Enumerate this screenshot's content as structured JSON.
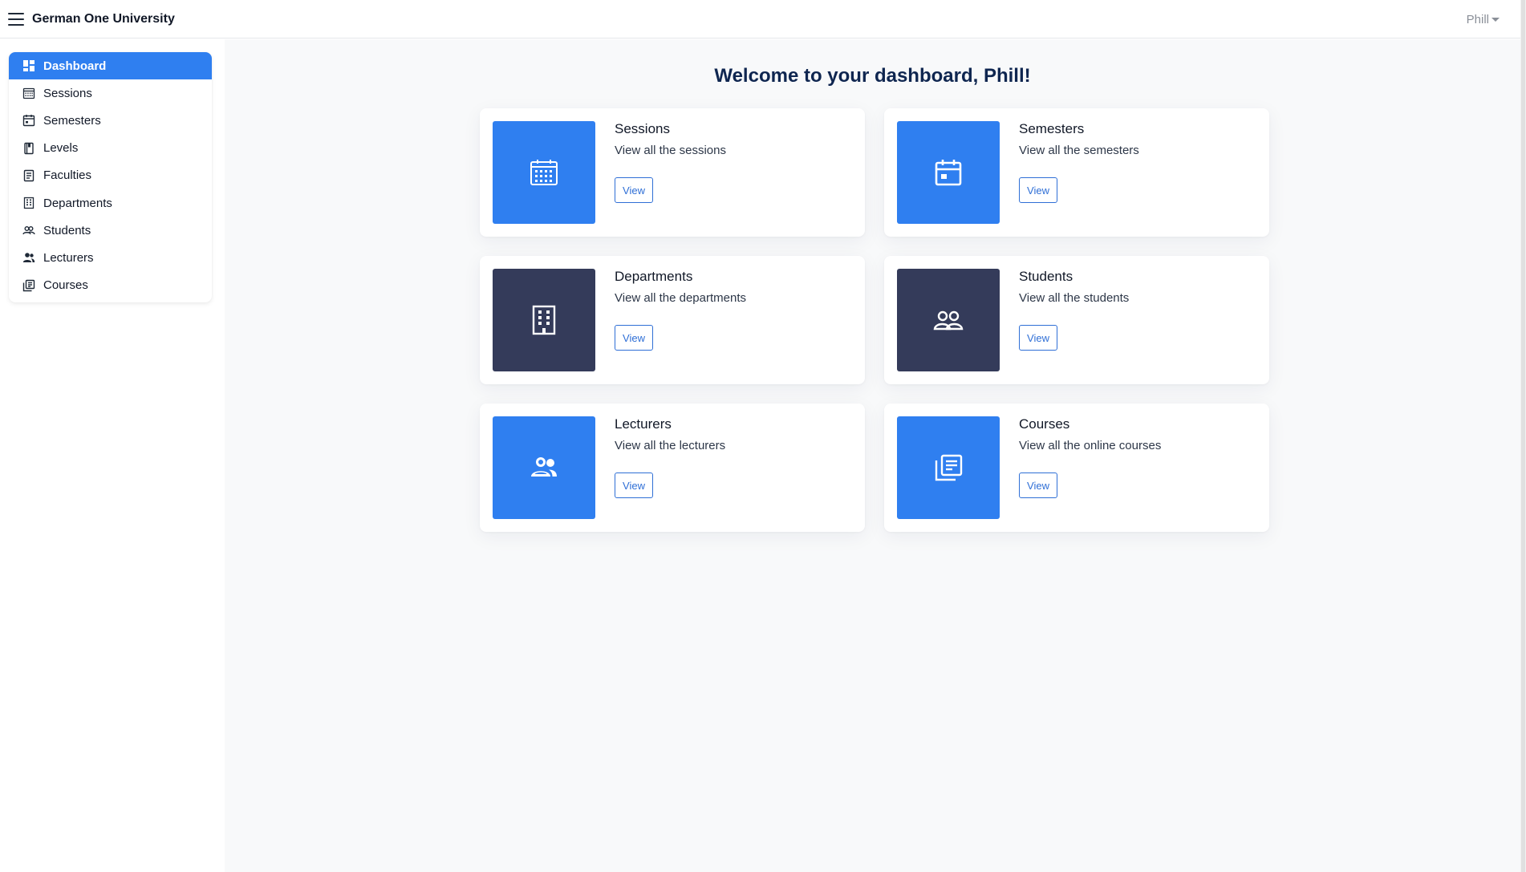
{
  "colors": {
    "accent": "#2f7ff0",
    "dark_tile": "#343b5a",
    "welcome_text": "#0f2650"
  },
  "navbar": {
    "menu_icon": "hamburger-icon",
    "brand": "German One University",
    "user_name": "Phill",
    "user_caret_icon": "caret-down-icon"
  },
  "sidebar": {
    "items": [
      {
        "label": "Dashboard",
        "icon": "dashboard-icon",
        "active": true
      },
      {
        "label": "Sessions",
        "icon": "calendar-grid-icon"
      },
      {
        "label": "Semesters",
        "icon": "calendar-icon"
      },
      {
        "label": "Levels",
        "icon": "book-icon"
      },
      {
        "label": "Faculties",
        "icon": "document-icon"
      },
      {
        "label": "Departments",
        "icon": "building-icon"
      },
      {
        "label": "Students",
        "icon": "users-icon"
      },
      {
        "label": "Lecturers",
        "icon": "lecturers-icon"
      },
      {
        "label": "Courses",
        "icon": "library-icon"
      }
    ]
  },
  "main": {
    "welcome": "Welcome to your dashboard, Phill!",
    "cards": [
      {
        "title": "Sessions",
        "description": "View all the sessions",
        "button": "View",
        "icon": "calendar-grid-icon",
        "tile": "blue"
      },
      {
        "title": "Semesters",
        "description": "View all the semesters",
        "button": "View",
        "icon": "calendar-icon",
        "tile": "blue"
      },
      {
        "title": "Departments",
        "description": "View all the departments",
        "button": "View",
        "icon": "building-icon",
        "tile": "dark"
      },
      {
        "title": "Students",
        "description": "View all the students",
        "button": "View",
        "icon": "users-icon",
        "tile": "dark"
      },
      {
        "title": "Lecturers",
        "description": "View all the lecturers",
        "button": "View",
        "icon": "lecturers-icon",
        "tile": "blue"
      },
      {
        "title": "Courses",
        "description": "View all the online courses",
        "button": "View",
        "icon": "library-icon",
        "tile": "blue"
      }
    ]
  }
}
